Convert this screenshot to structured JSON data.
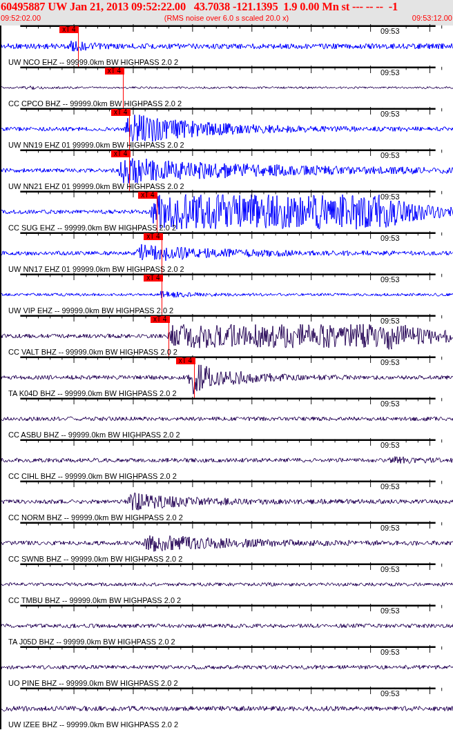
{
  "header": {
    "title": "60495887 UW Jan 21, 2013 09:52:22.00   43.7038 -121.1395  1.9 0.00 Mn st --- -- --  -1",
    "start_time": "09:52:02.00",
    "note": "(RMS noise over 6.0 s scaled 20.0 x)",
    "end_time": "09:53:12.00"
  },
  "traces": [
    {
      "station": "UW NCO EHZ -- 99999.0km BW HIGHPASS 2.0 2",
      "time_label": "09:53",
      "color": "#0000ff",
      "pick": {
        "label": "xT 4",
        "level": 0.171
      }
    },
    {
      "station": "CC CPCO BHZ -- 99999.0km BW HIGHPASS 2.0 2",
      "time_label": "09:53",
      "color": "#2a0a5a",
      "pick": {
        "label": "xT 4",
        "level": 0.271
      }
    },
    {
      "station": "UW NN19 EHZ 01 99999.0km BW HIGHPASS 2.0 2",
      "time_label": "09:53",
      "color": "#0000ff",
      "pick": {
        "label": "xT 4",
        "level": 0.285
      }
    },
    {
      "station": "UW NN21 EHZ 01 99999.0km BW HIGHPASS 2.0 2",
      "time_label": "09:53",
      "color": "#0000ff",
      "pick": {
        "label": "xT 4",
        "level": 0.285
      }
    },
    {
      "station": "CC SUG EHZ -- 99999.0km BW HIGHPASS 2.0 2",
      "time_label": "09:53",
      "color": "#0000ff",
      "pick": {
        "label": "xT 4",
        "level": 0.345
      }
    },
    {
      "station": "UW NN17 EHZ 01 99999.0km BW HIGHPASS 2.0 2",
      "time_label": "09:53",
      "color": "#0000ff",
      "pick": {
        "label": "xT 4",
        "level": 0.357
      }
    },
    {
      "station": "UW VIP EHZ -- 99999.0km BW HIGHPASS 2.0 2",
      "time_label": "09:53",
      "color": "#0000ff",
      "pick": {
        "label": "xT 4",
        "level": 0.357
      }
    },
    {
      "station": "CC VALT BHZ -- 99999.0km BW HIGHPASS 2.0 2",
      "time_label": "09:53",
      "color": "#2a0a5a",
      "pick": {
        "label": "xT 4",
        "level": 0.372
      }
    },
    {
      "station": "TA K04D BHZ -- 99999.0km BW HIGHPASS 2.0 2",
      "time_label": "09:53",
      "color": "#2a0a5a",
      "pick": {
        "label": "xT 4",
        "level": 0.428
      }
    },
    {
      "station": "CC ASBU BHZ -- 99999.0km BW HIGHPASS 2.0 2",
      "time_label": "09:53",
      "color": "#2a0a5a"
    },
    {
      "station": "CC CIHL BHZ -- 99999.0km BW HIGHPASS 2.0 2",
      "time_label": "09:53",
      "color": "#2a0a5a"
    },
    {
      "station": "CC NORM BHZ -- 99999.0km BW HIGHPASS 2.0 2",
      "time_label": "09:53",
      "color": "#2a0a5a"
    },
    {
      "station": "CC SWNB BHZ -- 99999.0km BW HIGHPASS 2.0 2",
      "time_label": "09:53",
      "color": "#2a0a5a"
    },
    {
      "station": "CC TMBU BHZ -- 99999.0km BW HIGHPASS 2.0 2",
      "time_label": "09:53",
      "color": "#2a0a5a"
    },
    {
      "station": "TA J05D BHZ -- 99999.0km BW HIGHPASS 2.0 2",
      "time_label": "09:53",
      "color": "#2a0a5a"
    },
    {
      "station": "UO PINE BHZ -- 99999.0km BW HIGHPASS 2.0 2",
      "time_label": "09:53",
      "color": "#2a0a5a"
    },
    {
      "station": "UW IZEE BHZ -- 99999.0km BW HIGHPASS 2.0 2",
      "time_label": "09:53",
      "color": "#2a0a5a"
    }
  ]
}
